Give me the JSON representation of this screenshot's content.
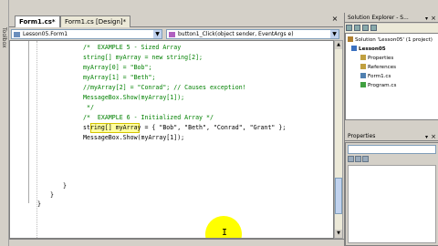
{
  "left_strip": {
    "toolbox_label": "Toolbox"
  },
  "tabs": [
    {
      "label": "Form1.cs*"
    },
    {
      "label": "Form1.cs [Design]*"
    }
  ],
  "dropdowns": {
    "class_selector": "Lesson05.Form1",
    "member_selector": "button1_Click(object sender, EventArgs e)"
  },
  "code_lines": [
    "/*  EXAMPLE 5 - Sized Array",
    "string[] myArray = new string[2];",
    "myArray[0] = \"Bob\";",
    "myArray[1] = \"Beth\";",
    "//myArray[2] = \"Conrad\"; // Causes exception!",
    "MessageBox.Show(myArray[1]);",
    " */",
    "",
    "/*  EXAMPLE 6 - Initialized Array */",
    "string[] myArray = { \"Bob\", \"Beth\", \"Conrad\", \"Grant\" };",
    "MessageBox.Show(myArray[1]);",
    "}",
    "}",
    "}"
  ],
  "solution_explorer": {
    "title": "Solution Explorer - S...",
    "items": [
      {
        "label": "Solution 'Lesson05' (1 project)"
      },
      {
        "label": "Lesson05"
      },
      {
        "label": "Properties"
      },
      {
        "label": "References"
      },
      {
        "label": "Form1.cs"
      },
      {
        "label": "Program.cs"
      }
    ]
  },
  "properties_panel": {
    "title": "Properties"
  },
  "cursor": {
    "glyph": "I"
  }
}
